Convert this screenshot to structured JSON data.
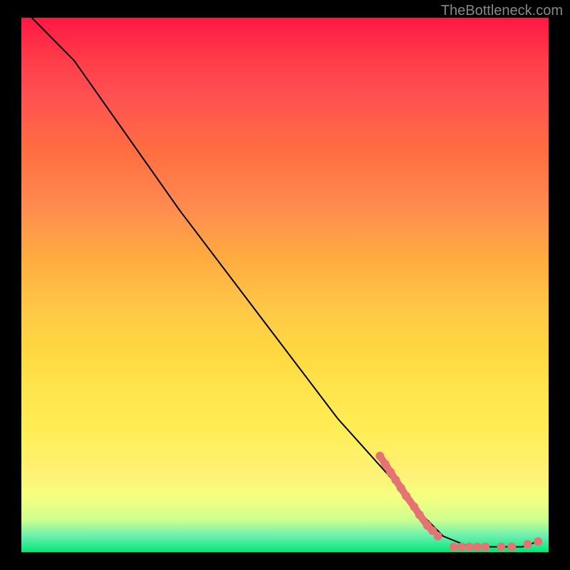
{
  "watermark": "TheBottleneck.com",
  "chart_data": {
    "type": "line",
    "title": "",
    "xlabel": "",
    "ylabel": "",
    "xlim": [
      0,
      100
    ],
    "ylim": [
      0,
      100
    ],
    "series": [
      {
        "name": "curve",
        "color": "#000000",
        "points": [
          {
            "x": 2,
            "y": 100
          },
          {
            "x": 5,
            "y": 97
          },
          {
            "x": 10,
            "y": 92
          },
          {
            "x": 15,
            "y": 85
          },
          {
            "x": 20,
            "y": 78
          },
          {
            "x": 30,
            "y": 64
          },
          {
            "x": 40,
            "y": 51
          },
          {
            "x": 50,
            "y": 38
          },
          {
            "x": 60,
            "y": 25
          },
          {
            "x": 70,
            "y": 14
          },
          {
            "x": 75,
            "y": 8
          },
          {
            "x": 80,
            "y": 3
          },
          {
            "x": 85,
            "y": 1
          },
          {
            "x": 90,
            "y": 1
          },
          {
            "x": 95,
            "y": 1
          },
          {
            "x": 98,
            "y": 2
          }
        ]
      }
    ],
    "markers": {
      "color": "#e57373",
      "points": [
        {
          "x": 68,
          "y": 18
        },
        {
          "x": 69,
          "y": 16.5
        },
        {
          "x": 70,
          "y": 15
        },
        {
          "x": 71,
          "y": 13.5
        },
        {
          "x": 72,
          "y": 12
        },
        {
          "x": 73,
          "y": 10.5
        },
        {
          "x": 74.5,
          "y": 8.5
        },
        {
          "x": 75.5,
          "y": 7
        },
        {
          "x": 77,
          "y": 5
        },
        {
          "x": 78,
          "y": 4
        },
        {
          "x": 79,
          "y": 3
        },
        {
          "x": 82,
          "y": 1
        },
        {
          "x": 83.5,
          "y": 1
        },
        {
          "x": 85,
          "y": 1
        },
        {
          "x": 86.5,
          "y": 1
        },
        {
          "x": 88,
          "y": 1
        },
        {
          "x": 91,
          "y": 1
        },
        {
          "x": 93,
          "y": 1
        },
        {
          "x": 96,
          "y": 1.5
        },
        {
          "x": 98,
          "y": 2
        }
      ]
    }
  }
}
